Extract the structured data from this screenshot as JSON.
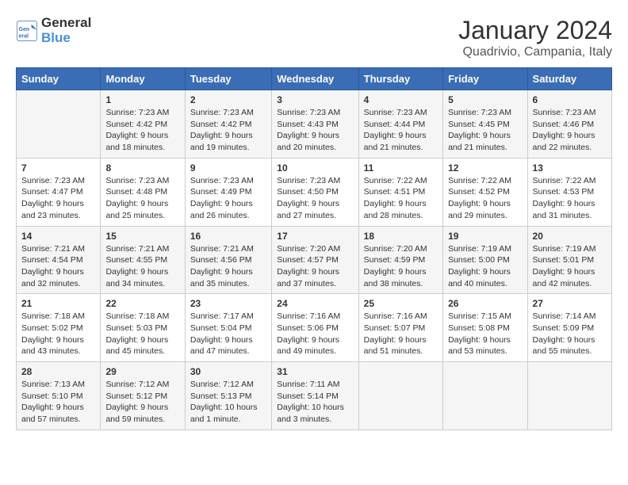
{
  "header": {
    "logo_line1": "General",
    "logo_line2": "Blue",
    "title": "January 2024",
    "subtitle": "Quadrivio, Campania, Italy"
  },
  "days_of_week": [
    "Sunday",
    "Monday",
    "Tuesday",
    "Wednesday",
    "Thursday",
    "Friday",
    "Saturday"
  ],
  "weeks": [
    [
      {
        "day": "",
        "info": ""
      },
      {
        "day": "1",
        "info": "Sunrise: 7:23 AM\nSunset: 4:42 PM\nDaylight: 9 hours\nand 18 minutes."
      },
      {
        "day": "2",
        "info": "Sunrise: 7:23 AM\nSunset: 4:42 PM\nDaylight: 9 hours\nand 19 minutes."
      },
      {
        "day": "3",
        "info": "Sunrise: 7:23 AM\nSunset: 4:43 PM\nDaylight: 9 hours\nand 20 minutes."
      },
      {
        "day": "4",
        "info": "Sunrise: 7:23 AM\nSunset: 4:44 PM\nDaylight: 9 hours\nand 21 minutes."
      },
      {
        "day": "5",
        "info": "Sunrise: 7:23 AM\nSunset: 4:45 PM\nDaylight: 9 hours\nand 21 minutes."
      },
      {
        "day": "6",
        "info": "Sunrise: 7:23 AM\nSunset: 4:46 PM\nDaylight: 9 hours\nand 22 minutes."
      }
    ],
    [
      {
        "day": "7",
        "info": "Sunrise: 7:23 AM\nSunset: 4:47 PM\nDaylight: 9 hours\nand 23 minutes."
      },
      {
        "day": "8",
        "info": "Sunrise: 7:23 AM\nSunset: 4:48 PM\nDaylight: 9 hours\nand 25 minutes."
      },
      {
        "day": "9",
        "info": "Sunrise: 7:23 AM\nSunset: 4:49 PM\nDaylight: 9 hours\nand 26 minutes."
      },
      {
        "day": "10",
        "info": "Sunrise: 7:23 AM\nSunset: 4:50 PM\nDaylight: 9 hours\nand 27 minutes."
      },
      {
        "day": "11",
        "info": "Sunrise: 7:22 AM\nSunset: 4:51 PM\nDaylight: 9 hours\nand 28 minutes."
      },
      {
        "day": "12",
        "info": "Sunrise: 7:22 AM\nSunset: 4:52 PM\nDaylight: 9 hours\nand 29 minutes."
      },
      {
        "day": "13",
        "info": "Sunrise: 7:22 AM\nSunset: 4:53 PM\nDaylight: 9 hours\nand 31 minutes."
      }
    ],
    [
      {
        "day": "14",
        "info": "Sunrise: 7:21 AM\nSunset: 4:54 PM\nDaylight: 9 hours\nand 32 minutes."
      },
      {
        "day": "15",
        "info": "Sunrise: 7:21 AM\nSunset: 4:55 PM\nDaylight: 9 hours\nand 34 minutes."
      },
      {
        "day": "16",
        "info": "Sunrise: 7:21 AM\nSunset: 4:56 PM\nDaylight: 9 hours\nand 35 minutes."
      },
      {
        "day": "17",
        "info": "Sunrise: 7:20 AM\nSunset: 4:57 PM\nDaylight: 9 hours\nand 37 minutes."
      },
      {
        "day": "18",
        "info": "Sunrise: 7:20 AM\nSunset: 4:59 PM\nDaylight: 9 hours\nand 38 minutes."
      },
      {
        "day": "19",
        "info": "Sunrise: 7:19 AM\nSunset: 5:00 PM\nDaylight: 9 hours\nand 40 minutes."
      },
      {
        "day": "20",
        "info": "Sunrise: 7:19 AM\nSunset: 5:01 PM\nDaylight: 9 hours\nand 42 minutes."
      }
    ],
    [
      {
        "day": "21",
        "info": "Sunrise: 7:18 AM\nSunset: 5:02 PM\nDaylight: 9 hours\nand 43 minutes."
      },
      {
        "day": "22",
        "info": "Sunrise: 7:18 AM\nSunset: 5:03 PM\nDaylight: 9 hours\nand 45 minutes."
      },
      {
        "day": "23",
        "info": "Sunrise: 7:17 AM\nSunset: 5:04 PM\nDaylight: 9 hours\nand 47 minutes."
      },
      {
        "day": "24",
        "info": "Sunrise: 7:16 AM\nSunset: 5:06 PM\nDaylight: 9 hours\nand 49 minutes."
      },
      {
        "day": "25",
        "info": "Sunrise: 7:16 AM\nSunset: 5:07 PM\nDaylight: 9 hours\nand 51 minutes."
      },
      {
        "day": "26",
        "info": "Sunrise: 7:15 AM\nSunset: 5:08 PM\nDaylight: 9 hours\nand 53 minutes."
      },
      {
        "day": "27",
        "info": "Sunrise: 7:14 AM\nSunset: 5:09 PM\nDaylight: 9 hours\nand 55 minutes."
      }
    ],
    [
      {
        "day": "28",
        "info": "Sunrise: 7:13 AM\nSunset: 5:10 PM\nDaylight: 9 hours\nand 57 minutes."
      },
      {
        "day": "29",
        "info": "Sunrise: 7:12 AM\nSunset: 5:12 PM\nDaylight: 9 hours\nand 59 minutes."
      },
      {
        "day": "30",
        "info": "Sunrise: 7:12 AM\nSunset: 5:13 PM\nDaylight: 10 hours\nand 1 minute."
      },
      {
        "day": "31",
        "info": "Sunrise: 7:11 AM\nSunset: 5:14 PM\nDaylight: 10 hours\nand 3 minutes."
      },
      {
        "day": "",
        "info": ""
      },
      {
        "day": "",
        "info": ""
      },
      {
        "day": "",
        "info": ""
      }
    ]
  ]
}
